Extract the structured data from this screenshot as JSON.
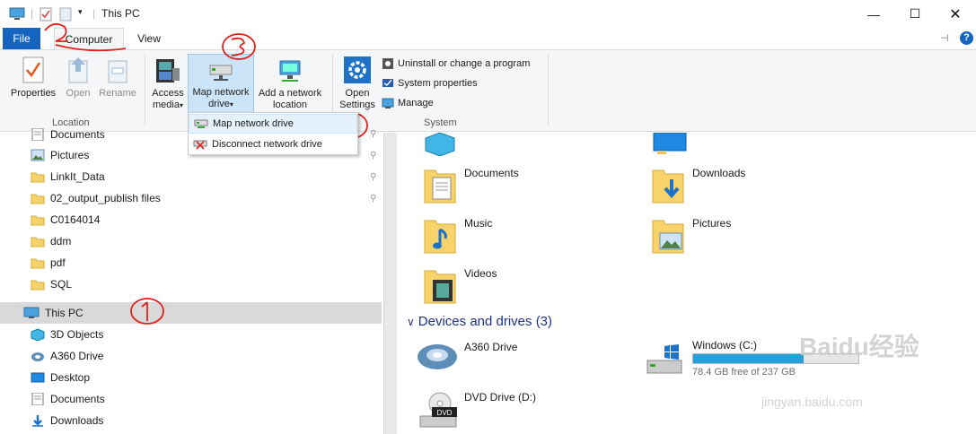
{
  "window": {
    "title": "This PC"
  },
  "tabs": {
    "file": "File",
    "computer": "Computer",
    "view": "View"
  },
  "ribbon": {
    "location": {
      "label": "Location",
      "properties": "Properties",
      "open": "Open",
      "rename": "Rename"
    },
    "network": {
      "access_media": "Access media",
      "map_network_drive": "Map network drive",
      "add_network_location": "Add a network location"
    },
    "system": {
      "label": "System",
      "open_settings": "Open Settings",
      "uninstall": "Uninstall or change a program",
      "system_properties": "System properties",
      "manage": "Manage"
    }
  },
  "dropdown": {
    "items": [
      "Map network drive",
      "Disconnect network drive"
    ]
  },
  "nav": {
    "quick_access": [
      {
        "label": "Documents",
        "pinned": true
      },
      {
        "label": "Pictures",
        "pinned": true
      },
      {
        "label": "LinkIt_Data",
        "pinned": true
      },
      {
        "label": "02_output_publish files",
        "pinned": true
      },
      {
        "label": "C0164014",
        "pinned": false
      },
      {
        "label": "ddm",
        "pinned": false
      },
      {
        "label": "pdf",
        "pinned": false
      },
      {
        "label": "SQL",
        "pinned": false
      }
    ],
    "this_pc": "This PC",
    "this_pc_children": [
      "3D Objects",
      "A360 Drive",
      "Desktop",
      "Documents",
      "Downloads"
    ]
  },
  "folders": [
    "Documents",
    "Downloads",
    "Music",
    "Pictures",
    "Videos"
  ],
  "devices": {
    "header": "Devices and drives (3)",
    "drives": [
      {
        "name": "A360 Drive"
      },
      {
        "name": "Windows (C:)",
        "free": "78.4 GB free of 237 GB",
        "used_fraction": 0.67
      },
      {
        "name": "DVD Drive (D:)"
      }
    ]
  },
  "annotations": [
    "1",
    "2",
    "3",
    "4"
  ],
  "watermark": {
    "brand": "Baidu经验",
    "url": "jingyan.baidu.com"
  },
  "colors": {
    "accent": "#1565c0",
    "drive_fill": "#26a0da",
    "annotation": "#e0201b",
    "section": "#1e3287"
  }
}
